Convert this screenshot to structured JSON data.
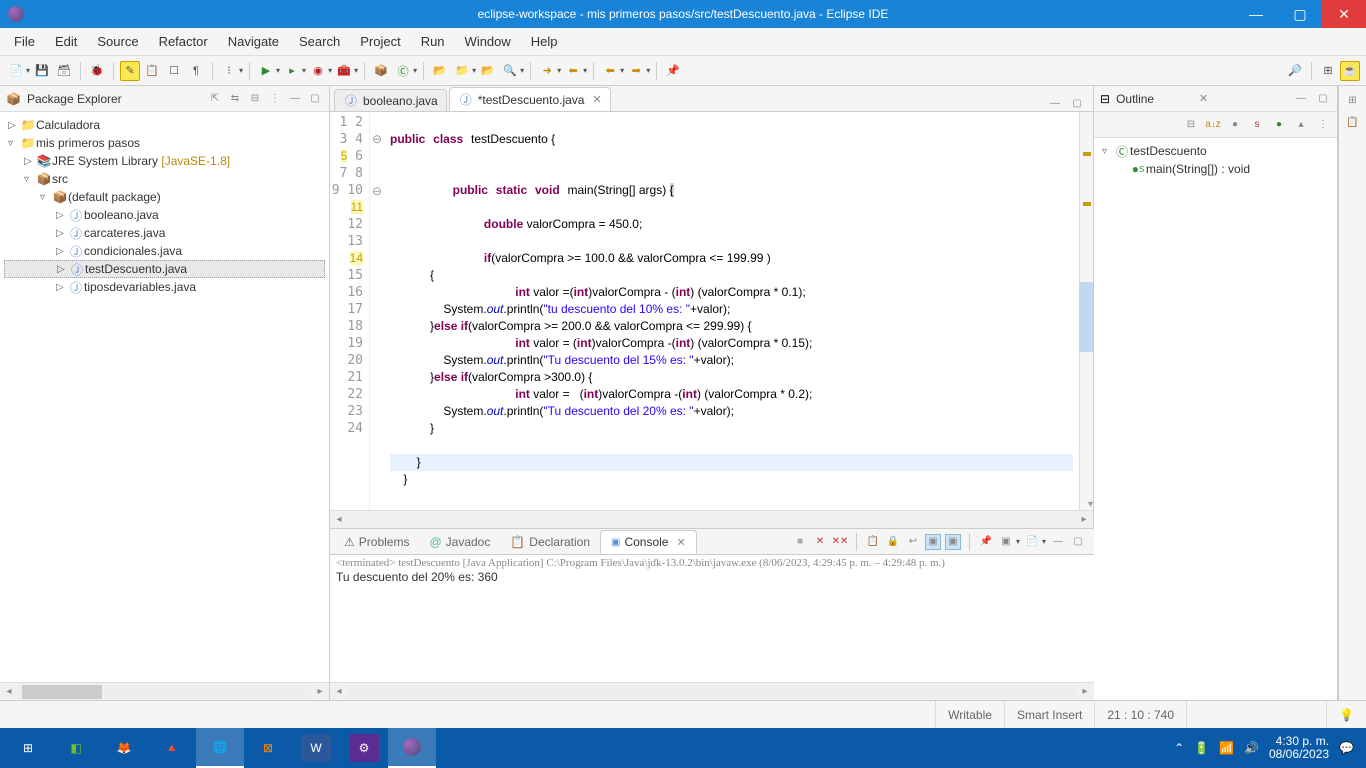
{
  "title": "eclipse-workspace - mis primeros pasos/src/testDescuento.java - Eclipse IDE",
  "menu": [
    "File",
    "Edit",
    "Source",
    "Refactor",
    "Navigate",
    "Search",
    "Project",
    "Run",
    "Window",
    "Help"
  ],
  "views": {
    "pkg": {
      "title": "Package Explorer",
      "items": {
        "calc": "Calculadora",
        "proj": "mis primeros pasos",
        "jre": "JRE System Library",
        "jre_ver": "[JavaSE-1.8]",
        "src": "src",
        "pkg_default": "(default package)",
        "f1": "booleano.java",
        "f2": "carcateres.java",
        "f3": "condicionales.java",
        "f4": "testDescuento.java",
        "f5": "tiposdevariables.java"
      }
    },
    "outline": {
      "title": "Outline",
      "class": "testDescuento",
      "method": "main(String[]) : void"
    }
  },
  "editor": {
    "tab1": "booleano.java",
    "tab2": "*testDescuento.java"
  },
  "code": {
    "l1": "",
    "l2_kw1": "public",
    "l2_kw2": "class",
    "l2_name": "testDescuento",
    "l2_end": " {",
    "l3": "",
    "l4": "",
    "l5_kw1": "public",
    "l5_kw2": "static",
    "l5_kw3": "void",
    "l5_name": "main",
    "l5_args": "(String[] args) ",
    "l5_brace": "{",
    "l6": "",
    "l7_kw": "double",
    "l7_rest": " valorCompra = 450.0;",
    "l8": "",
    "l9_kw": "if",
    "l9_rest": "(valorCompra >= 100.0 && valorCompra <= 199.99 )",
    "l10": "            {",
    "l11_kw": "int",
    "l11_rest": " valor =(",
    "l11_kw2": "int",
    "l11_rest2": ")valorCompra - (",
    "l11_kw3": "int",
    "l11_rest3": ") (valorCompra * 0.1);",
    "l12_a": "                System.",
    "l12_out": "out",
    "l12_b": ".println(",
    "l12_s": "\"tu descuento del 10% es: \"",
    "l12_c": "+valor);",
    "l13_a": "            }",
    "l13_kw": "else if",
    "l13_b": "(valorCompra >= 200.0 && valorCompra <= 299.99) {",
    "l14_kw": "int",
    "l14_rest": " valor = (",
    "l14_kw2": "int",
    "l14_rest2": ")valorCompra -(",
    "l14_kw3": "int",
    "l14_rest3": ") (valorCompra * 0.15);",
    "l15_a": "                System.",
    "l15_out": "out",
    "l15_b": ".println(",
    "l15_s": "\"Tu descuento del 15% es: \"",
    "l15_c": "+valor);",
    "l16_a": "            }",
    "l16_kw": "else if",
    "l16_b": "(valorCompra >300.0) {",
    "l17_kw": "int",
    "l17_rest": " valor =   (",
    "l17_kw2": "int",
    "l17_rest2": ")valorCompra -(",
    "l17_kw3": "int",
    "l17_rest3": ") (valorCompra * 0.2);",
    "l18_a": "                System.",
    "l18_out": "out",
    "l18_b": ".println(",
    "l18_s": "\"Tu descuento del 20% es: \"",
    "l18_c": "+valor);",
    "l19": "            }",
    "l20": "",
    "l21": "        }",
    "l22": "    }",
    "l23": "",
    "l24": ""
  },
  "bottom": {
    "tabs": {
      "problems": "Problems",
      "javadoc": "Javadoc",
      "decl": "Declaration",
      "console": "Console"
    },
    "console_header": "<terminated> testDescuento [Java Application] C:\\Program Files\\Java\\jdk-13.0.2\\bin\\javaw.exe  (8/06/2023, 4:29:45 p. m. – 4:29:48 p. m.)",
    "console_line": "Tu descuento del 20% es: 360"
  },
  "status": {
    "writable": "Writable",
    "insert": "Smart Insert",
    "pos": "21 : 10 : 740"
  },
  "taskbar": {
    "time": "4:30 p. m.",
    "date": "08/06/2023"
  }
}
